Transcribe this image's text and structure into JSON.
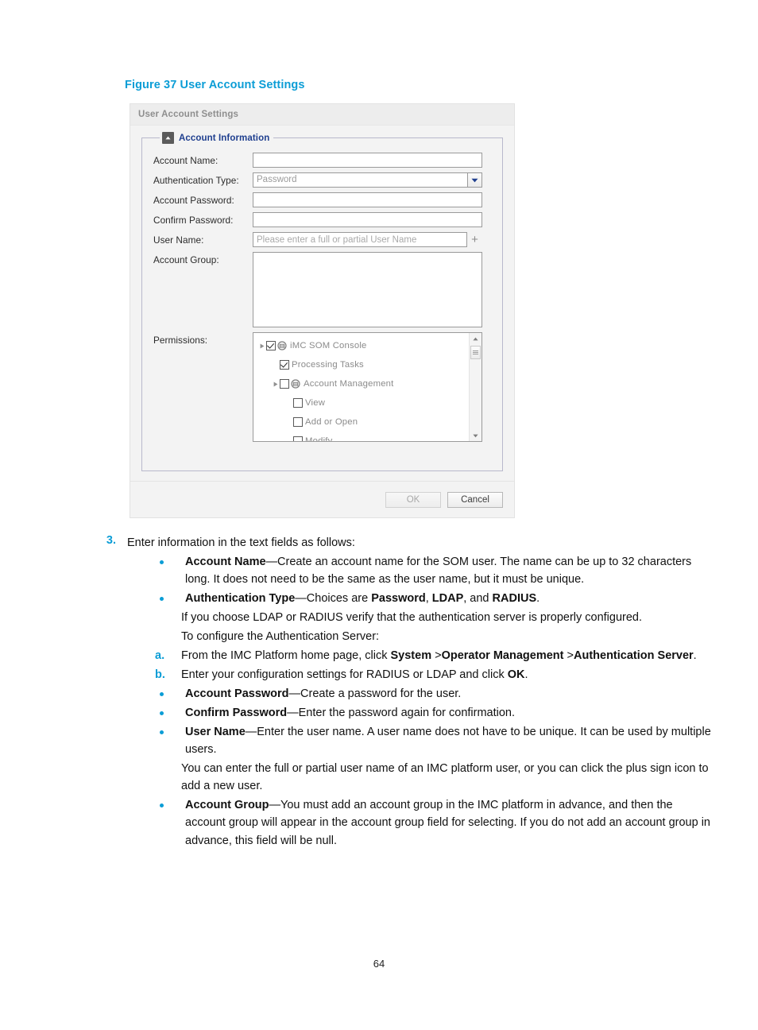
{
  "figure": {
    "caption": "Figure 37 User Account Settings",
    "caption_color": "#0b9dd6"
  },
  "dialog": {
    "title": "User Account Settings",
    "group": {
      "legend": "Account Information",
      "collapse_icon": "triangle-up-icon"
    },
    "fields": {
      "account_name": {
        "label": "Account Name:",
        "value": "",
        "placeholder": ""
      },
      "authentication_type": {
        "label": "Authentication Type:",
        "value": "Password",
        "options": [
          "Password",
          "LDAP",
          "RADIUS"
        ],
        "arrow_icon": "chevron-down-icon"
      },
      "account_password": {
        "label": "Account Password:",
        "value": "",
        "placeholder": ""
      },
      "confirm_password": {
        "label": "Confirm Password:",
        "value": "",
        "placeholder": ""
      },
      "user_name": {
        "label": "User Name:",
        "value": "",
        "placeholder": "Please enter a full or partial User Name",
        "add_icon": "plus-icon"
      },
      "account_group": {
        "label": "Account Group:",
        "value": ""
      },
      "permissions": {
        "label": "Permissions:"
      }
    },
    "permissions_tree": [
      {
        "label": "iMC SOM Console",
        "depth": 0,
        "checked": true,
        "expander": true,
        "folder": true
      },
      {
        "label": "Processing Tasks",
        "depth": 1,
        "checked": true,
        "expander": false,
        "folder": false
      },
      {
        "label": "Account Management",
        "depth": 1,
        "checked": false,
        "expander": true,
        "folder": true
      },
      {
        "label": "View",
        "depth": 2,
        "checked": false,
        "expander": false,
        "folder": false
      },
      {
        "label": "Add or Open",
        "depth": 2,
        "checked": false,
        "expander": false,
        "folder": false
      },
      {
        "label": "Modify",
        "depth": 2,
        "checked": false,
        "expander": false,
        "folder": false
      }
    ],
    "footer": {
      "ok_label": "OK",
      "cancel_label": "Cancel"
    },
    "scrollbar": {
      "up_icon": "triangle-up-icon",
      "down_icon": "triangle-down-icon"
    }
  },
  "content": {
    "step3_number": "3.",
    "step3_text": "Enter information in the text fields as follows:",
    "b1_strong": "Account Name",
    "b1_rest": "—Create an account name for the SOM user. The name can be up to 32 characters long. It does not need to be the same as the user name, but it must be unique.",
    "b2_strong": "Authentication Type",
    "b2_mid": "—Choices are ",
    "b2_opt1": "Password",
    "b2_sep1": ", ",
    "b2_opt2": "LDAP",
    "b2_sep2": ", and ",
    "b2_opt3": "RADIUS",
    "b2_end": ".",
    "p1": "If you choose LDAP or RADIUS verify that the authentication server is properly configured.",
    "p2": "To configure the Authentication Server:",
    "a_mark": "a.",
    "a_pre": "From the IMC Platform home page, click ",
    "a_s1": "System",
    "a_sep1": " >",
    "a_s2": "Operator Management",
    "a_sep2": " >",
    "a_s3": "Authentication Server",
    "a_end": ".",
    "b_mark": "b.",
    "b_pre": "Enter your configuration settings for RADIUS or LDAP and click ",
    "b_s1": "OK",
    "b_end": ".",
    "b3_strong": "Account Password",
    "b3_rest": "—Create a password for the user.",
    "b4_strong": "Confirm Password",
    "b4_rest": "—Enter the password again for confirmation.",
    "b5_strong": "User Name",
    "b5_rest": "—Enter the user name. A user name does not have to be unique. It can be used by multiple users.",
    "p3": "You can enter the full or partial user name of an IMC platform user, or you can click the plus sign icon to add a new user.",
    "b6_strong": "Account Group",
    "b6_rest": "—You must add an account group in the IMC platform in advance, and then the account group will appear in the account group field for selecting. If you do not add an account group in advance, this field will be null."
  },
  "page_number": "64"
}
